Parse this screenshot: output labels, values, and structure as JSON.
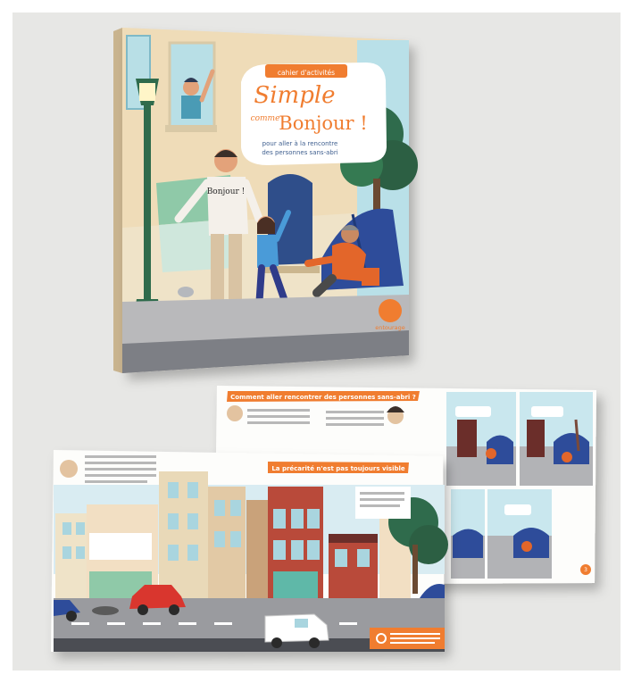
{
  "cover": {
    "badge": "cahier d'activités",
    "title_line1": "Simple",
    "title_comme": "comme",
    "title_line2": "Bonjour !",
    "subtitle_line1": "pour aller à la rencontre",
    "subtitle_line2": "des personnes sans-abri",
    "shirt_text": "Bonjour !",
    "publisher": "entourage"
  },
  "back_spread": {
    "heading": "Comment aller rencontrer des personnes sans-abri ?",
    "page_number": "3"
  },
  "front_spread": {
    "heading": "La précarité n'est pas toujours visible"
  },
  "colors": {
    "orange": "#f07d30",
    "dark_blue": "#1f3a78",
    "sky": "#7ec2d8",
    "background": "#e7e7e5"
  }
}
